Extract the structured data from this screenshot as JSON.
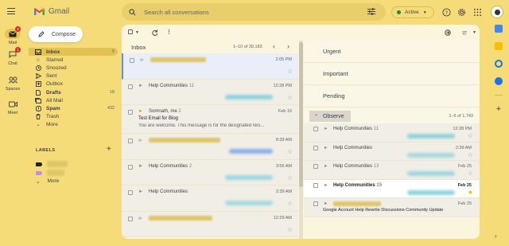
{
  "app": {
    "title": "Gmail",
    "search_placeholder": "Search all conversations",
    "status": "Active"
  },
  "rail": {
    "items": [
      {
        "label": "Mail",
        "badge": "4"
      },
      {
        "label": "Chat",
        "badge": "1"
      },
      {
        "label": "Spaces"
      },
      {
        "label": "Meet"
      }
    ]
  },
  "compose_label": "Compose",
  "nav": {
    "items": [
      {
        "label": "Inbox",
        "count": "5",
        "icon": "inbox-icon"
      },
      {
        "label": "Starred",
        "count": "",
        "icon": "star-icon"
      },
      {
        "label": "Snoozed",
        "count": "",
        "icon": "clock-icon"
      },
      {
        "label": "Sent",
        "count": "",
        "icon": "send-icon"
      },
      {
        "label": "Outbox",
        "count": "",
        "icon": "outbox-icon"
      },
      {
        "label": "Drafts",
        "count": "18",
        "icon": "draft-icon"
      },
      {
        "label": "All Mail",
        "count": "",
        "icon": "all-mail-icon"
      },
      {
        "label": "Spam",
        "count": "432",
        "icon": "spam-icon"
      },
      {
        "label": "Trash",
        "count": "",
        "icon": "trash-icon"
      },
      {
        "label": "More",
        "count": "",
        "icon": "chevron-down-icon"
      }
    ],
    "labels_heading": "LABELS",
    "labels_more": "More",
    "label_colors": [
      "#202124",
      "#c58af9"
    ]
  },
  "inbox": {
    "title": "Inbox",
    "range": "1–10 of 39,183",
    "toolbar_lang": "বা",
    "rows": [
      {
        "sender": "",
        "time": "2:05 PM",
        "subject": "",
        "snippet": ""
      },
      {
        "sender": "Help Communities",
        "count": "11",
        "time": "12:28 PM",
        "subject": "",
        "snippet": ""
      },
      {
        "sender": "Somnath, me",
        "count": "2",
        "time": "Feb 16",
        "subject": "Test Email for Blog",
        "snippet": "You are welcome. This message is for the designated reci..."
      },
      {
        "sender": "",
        "time": "8:39 AM",
        "subject": "",
        "snippet": ""
      },
      {
        "sender": "Help Communities",
        "count": "2",
        "time": "3:56 AM",
        "subject": "",
        "snippet": ""
      },
      {
        "sender": "Help Communities",
        "count": "",
        "time": "2:39 AM",
        "subject": "",
        "snippet": ""
      },
      {
        "sender": "",
        "time": "12:29 AM",
        "subject": "",
        "snippet": ""
      }
    ]
  },
  "sections": {
    "urgent": "Urgent",
    "important": "Important",
    "pending": "Pending",
    "observe": "Observe",
    "observe_range": "1–5 of 1,743"
  },
  "observe_rows": [
    {
      "sender": "Help Communities",
      "count": "11",
      "time": "12:28 PM"
    },
    {
      "sender": "Help Communities",
      "count": "",
      "time": "2:39 AM"
    },
    {
      "sender": "Help Communities",
      "count": "13",
      "time": "Feb 25"
    },
    {
      "sender": "Help Communities",
      "count": "15",
      "time": "Feb 25",
      "bold": true,
      "starred": true
    },
    {
      "sender": "",
      "count": "",
      "time": "Feb 25",
      "subject": "Google Account Help Rewrite Discussions Community Update"
    }
  ],
  "colors": {
    "background": "#f6dc78",
    "panel": "#fbf5de",
    "accent": "#e3c252",
    "active_dot": "#1e8e3e",
    "badge": "#d93025",
    "star": "#f4b400"
  }
}
